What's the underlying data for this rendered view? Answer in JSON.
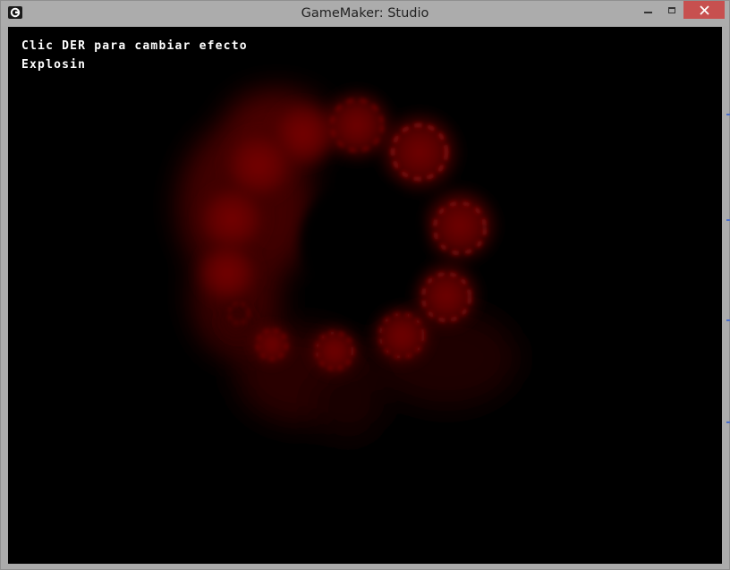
{
  "window": {
    "title": "GameMaker: Studio",
    "icon": "gamemaker-icon"
  },
  "controls": {
    "minimize": "minimize-icon",
    "maximize": "maximize-icon",
    "close": "close-icon",
    "close_color": "#c7504f"
  },
  "game": {
    "background": "#000000",
    "hud": {
      "line1": "Clic DER para cambiar efecto",
      "line2": "Explosin"
    },
    "effect": {
      "name": "explosion-ring",
      "color": "#8b0000"
    }
  }
}
